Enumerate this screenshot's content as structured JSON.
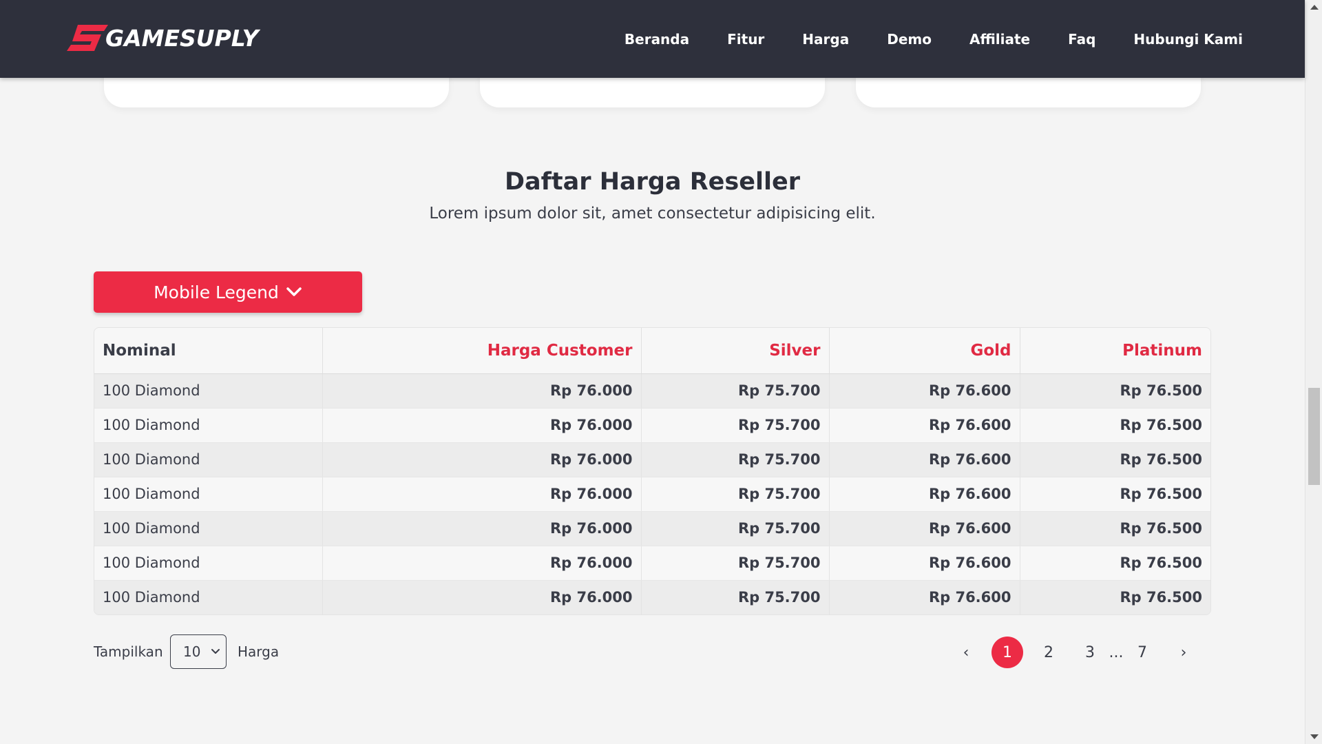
{
  "brand": {
    "name": "GAMESUPLY",
    "accent": "#ec2b45",
    "nav_bg": "#2e303c"
  },
  "nav": [
    "Beranda",
    "Fitur",
    "Harga",
    "Demo",
    "Affiliate",
    "Faq",
    "Hubungi Kami"
  ],
  "section": {
    "title": "Daftar Harga Reseller",
    "subtitle": "Lorem ipsum dolor sit, amet consectetur adipisicing elit."
  },
  "game_select": {
    "label": "Mobile Legend",
    "icon": "chevron-down-icon"
  },
  "table": {
    "headers": [
      "Nominal",
      "Harga Customer",
      "Silver",
      "Gold",
      "Platinum"
    ],
    "rows": [
      [
        "100 Diamond",
        "Rp 76.000",
        "Rp 75.700",
        "Rp 76.600",
        "Rp 76.500"
      ],
      [
        "100 Diamond",
        "Rp 76.000",
        "Rp 75.700",
        "Rp 76.600",
        "Rp 76.500"
      ],
      [
        "100 Diamond",
        "Rp 76.000",
        "Rp 75.700",
        "Rp 76.600",
        "Rp 76.500"
      ],
      [
        "100 Diamond",
        "Rp 76.000",
        "Rp 75.700",
        "Rp 76.600",
        "Rp 76.500"
      ],
      [
        "100 Diamond",
        "Rp 76.000",
        "Rp 75.700",
        "Rp 76.600",
        "Rp 76.500"
      ],
      [
        "100 Diamond",
        "Rp 76.000",
        "Rp 75.700",
        "Rp 76.600",
        "Rp 76.500"
      ],
      [
        "100 Diamond",
        "Rp 76.000",
        "Rp 75.700",
        "Rp 76.600",
        "Rp 76.500"
      ]
    ]
  },
  "page_size": {
    "label_before": "Tampilkan",
    "value": "10",
    "label_after": "Harga"
  },
  "pagination": {
    "prev": "‹",
    "pages": [
      "1",
      "2",
      "3"
    ],
    "dots": "...",
    "last": "7",
    "next": "›",
    "current": "1"
  }
}
